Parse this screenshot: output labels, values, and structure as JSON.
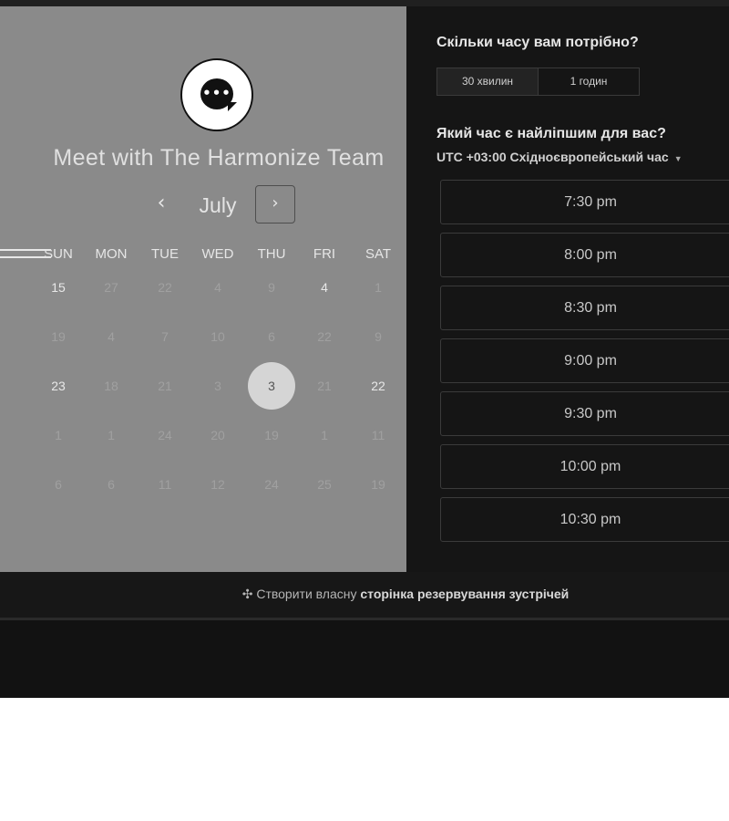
{
  "calendar": {
    "title": "Meet with The Harmonize Team",
    "month": "July",
    "prev_icon": "‹",
    "next_icon": "›",
    "weekdays": [
      "SUN",
      "MON",
      "TUE",
      "WED",
      "THU",
      "FRI",
      "SAT"
    ],
    "weeks": [
      [
        "15",
        "27",
        "22",
        "4",
        "9",
        "4",
        "1"
      ],
      [
        "19",
        "4",
        "7",
        "10",
        "6",
        "22",
        "9"
      ],
      [
        "23",
        "18",
        "21",
        "3",
        "3",
        "21",
        "22"
      ],
      [
        "1",
        "1",
        "24",
        "20",
        "19",
        "1",
        "11"
      ],
      [
        "6",
        "6",
        "11",
        "12",
        "24",
        "25",
        "19"
      ]
    ],
    "selected_day": "3"
  },
  "booking": {
    "duration_question": "Скільки часу вам потрібно?",
    "durations": [
      "30 хвилин",
      "1 годин"
    ],
    "time_question": "Який час є найліпшим для вас?",
    "timezone": "UTC +03:00 Східноєвропейський час",
    "time_slots": [
      "7:30 pm",
      "8:00 pm",
      "8:30 pm",
      "9:00 pm",
      "9:30 pm",
      "10:00 pm",
      "10:30 pm"
    ]
  },
  "footer": {
    "prefix": "Створити власну",
    "link": "сторінка резервування зустрічей",
    "icon": "hubspot-sprocket-icon"
  },
  "colors": {
    "left_panel": "#8a8a8a",
    "right_panel": "#151515",
    "selected_day_bg": "#d5d5d5"
  }
}
